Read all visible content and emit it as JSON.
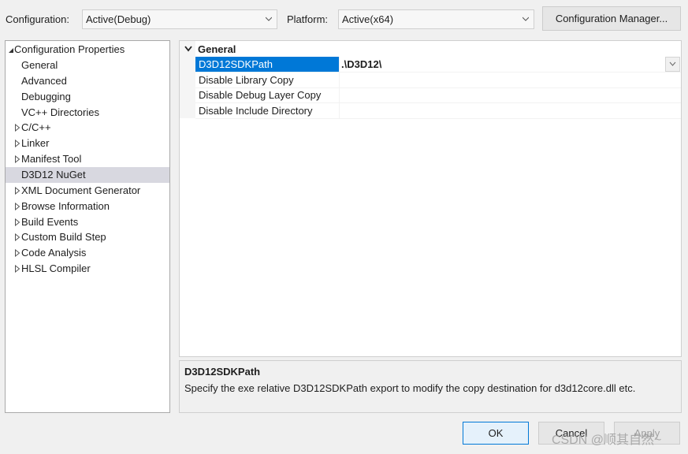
{
  "top": {
    "configuration_label": "Configuration:",
    "configuration_value": "Active(Debug)",
    "platform_label": "Platform:",
    "platform_value": "Active(x64)",
    "config_manager_button": "Configuration Manager..."
  },
  "tree": {
    "root": "Configuration Properties",
    "items": [
      {
        "label": "General",
        "expandable": false
      },
      {
        "label": "Advanced",
        "expandable": false
      },
      {
        "label": "Debugging",
        "expandable": false
      },
      {
        "label": "VC++ Directories",
        "expandable": false
      },
      {
        "label": "C/C++",
        "expandable": true
      },
      {
        "label": "Linker",
        "expandable": true
      },
      {
        "label": "Manifest Tool",
        "expandable": true
      },
      {
        "label": "D3D12 NuGet",
        "expandable": false,
        "selected": true
      },
      {
        "label": "XML Document Generator",
        "expandable": true
      },
      {
        "label": "Browse Information",
        "expandable": true
      },
      {
        "label": "Build Events",
        "expandable": true
      },
      {
        "label": "Custom Build Step",
        "expandable": true
      },
      {
        "label": "Code Analysis",
        "expandable": true
      },
      {
        "label": "HLSL Compiler",
        "expandable": true
      }
    ]
  },
  "grid": {
    "category": "General",
    "properties": [
      {
        "name": "D3D12SDKPath",
        "value": ".\\D3D12\\",
        "selected": true
      },
      {
        "name": "Disable Library Copy",
        "value": ""
      },
      {
        "name": "Disable Debug Layer Copy",
        "value": ""
      },
      {
        "name": "Disable Include Directory",
        "value": ""
      }
    ]
  },
  "description": {
    "title": "D3D12SDKPath",
    "text": "Specify the exe relative D3D12SDKPath export to modify the copy destination for d3d12core.dll etc."
  },
  "buttons": {
    "ok": "OK",
    "cancel": "Cancel",
    "apply": "Apply"
  },
  "watermark": "CSDN @顺其自然~",
  "colors": {
    "selection_blue": "#0078d7",
    "tree_selection": "#d8d8e0",
    "window_bg": "#f0f0f0"
  }
}
